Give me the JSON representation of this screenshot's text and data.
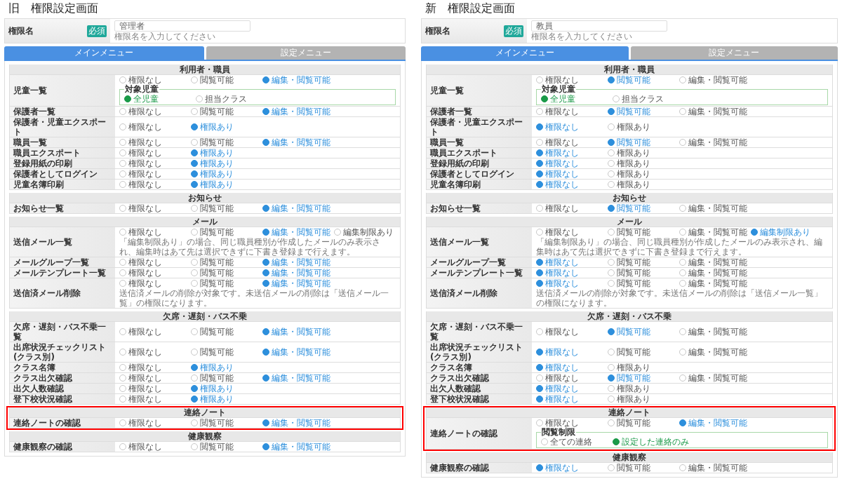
{
  "left": {
    "heading": "旧　権限設定画面",
    "name_field": {
      "label": "権限名",
      "badge": "必須",
      "value": "管理者",
      "hint": "権限名を入力してください"
    },
    "tabs": [
      {
        "label": "メインメニュー",
        "selected": true
      },
      {
        "label": "設定メニュー",
        "selected": false
      }
    ],
    "sections": [
      {
        "title": "利用者・職員",
        "highlighted": false,
        "rows": [
          {
            "label": "児童一覧",
            "options": [
              {
                "label": "権限なし",
                "selected": false
              },
              {
                "label": "閲覧可能",
                "selected": false
              },
              {
                "label": "編集・閲覧可能",
                "selected": true
              }
            ],
            "sub": {
              "title": "対象児童",
              "options": [
                {
                  "label": "全児童",
                  "selected": true
                },
                {
                  "label": "担当クラス",
                  "selected": false
                }
              ]
            }
          },
          {
            "label": "保護者一覧",
            "options": [
              {
                "label": "権限なし",
                "selected": false
              },
              {
                "label": "閲覧可能",
                "selected": false
              },
              {
                "label": "編集・閲覧可能",
                "selected": true
              }
            ]
          },
          {
            "label": "保護者・児童エクスポート",
            "options": [
              {
                "label": "権限なし",
                "selected": false
              },
              {
                "label": "権限あり",
                "selected": true
              }
            ]
          },
          {
            "label": "職員一覧",
            "options": [
              {
                "label": "権限なし",
                "selected": false
              },
              {
                "label": "閲覧可能",
                "selected": false
              },
              {
                "label": "編集・閲覧可能",
                "selected": true
              }
            ]
          },
          {
            "label": "職員エクスポート",
            "options": [
              {
                "label": "権限なし",
                "selected": false
              },
              {
                "label": "権限あり",
                "selected": true
              }
            ]
          },
          {
            "label": "登録用紙の印刷",
            "options": [
              {
                "label": "権限なし",
                "selected": false
              },
              {
                "label": "権限あり",
                "selected": true
              }
            ]
          },
          {
            "label": "保護者としてログイン",
            "options": [
              {
                "label": "権限なし",
                "selected": false
              },
              {
                "label": "権限あり",
                "selected": true
              }
            ]
          },
          {
            "label": "児童名簿印刷",
            "options": [
              {
                "label": "権限なし",
                "selected": false
              },
              {
                "label": "権限あり",
                "selected": true
              }
            ]
          }
        ]
      },
      {
        "title": "お知らせ",
        "highlighted": false,
        "rows": [
          {
            "label": "お知らせ一覧",
            "options": [
              {
                "label": "権限なし",
                "selected": false
              },
              {
                "label": "閲覧可能",
                "selected": false
              },
              {
                "label": "編集・閲覧可能",
                "selected": true
              }
            ]
          }
        ]
      },
      {
        "title": "メール",
        "highlighted": false,
        "rows": [
          {
            "label": "送信メール一覧",
            "options": [
              {
                "label": "権限なし",
                "selected": false
              },
              {
                "label": "閲覧可能",
                "selected": false
              },
              {
                "label": "編集・閲覧可能",
                "selected": true
              },
              {
                "label": "編集制限あり",
                "selected": false
              }
            ],
            "note": "「編集制限あり」の場合、同じ職員種別が作成したメールのみ表示され、編集時はあて先は選択できずに下書き登録まで行えます。"
          },
          {
            "label": "メールグループ一覧",
            "options": [
              {
                "label": "権限なし",
                "selected": false
              },
              {
                "label": "閲覧可能",
                "selected": false
              },
              {
                "label": "編集・閲覧可能",
                "selected": true
              }
            ]
          },
          {
            "label": "メールテンプレート一覧",
            "options": [
              {
                "label": "権限なし",
                "selected": false
              },
              {
                "label": "閲覧可能",
                "selected": false
              },
              {
                "label": "編集・閲覧可能",
                "selected": true
              }
            ]
          },
          {
            "label": "送信済メール削除",
            "options": [
              {
                "label": "権限なし",
                "selected": false
              },
              {
                "label": "閲覧可能",
                "selected": false
              },
              {
                "label": "編集・閲覧可能",
                "selected": true
              }
            ],
            "note": "送信済メールの削除が対象です。未送信メールの削除は「送信メール一覧」の権限になります。"
          }
        ]
      },
      {
        "title": "欠席・遅刻・バス不乗",
        "highlighted": false,
        "rows": [
          {
            "label": "欠席・遅刻・バス不乗一覧",
            "options": [
              {
                "label": "権限なし",
                "selected": false
              },
              {
                "label": "閲覧可能",
                "selected": false
              },
              {
                "label": "編集・閲覧可能",
                "selected": true
              }
            ]
          },
          {
            "label": "出席状況チェックリスト(クラス別)",
            "options": [
              {
                "label": "権限なし",
                "selected": false
              },
              {
                "label": "閲覧可能",
                "selected": false
              },
              {
                "label": "編集・閲覧可能",
                "selected": true
              }
            ]
          },
          {
            "label": "クラス名簿",
            "options": [
              {
                "label": "権限なし",
                "selected": false
              },
              {
                "label": "権限あり",
                "selected": true
              }
            ]
          },
          {
            "label": "クラス出欠確認",
            "options": [
              {
                "label": "権限なし",
                "selected": false
              },
              {
                "label": "閲覧可能",
                "selected": false
              },
              {
                "label": "編集・閲覧可能",
                "selected": true
              }
            ]
          },
          {
            "label": "出欠人数確認",
            "options": [
              {
                "label": "権限なし",
                "selected": false
              },
              {
                "label": "権限あり",
                "selected": true
              }
            ]
          },
          {
            "label": "登下校状況確認",
            "options": [
              {
                "label": "権限なし",
                "selected": false
              },
              {
                "label": "権限あり",
                "selected": true
              }
            ]
          }
        ]
      },
      {
        "title": "連絡ノート",
        "highlighted": true,
        "rows": [
          {
            "label": "連絡ノートの確認",
            "options": [
              {
                "label": "権限なし",
                "selected": false
              },
              {
                "label": "閲覧可能",
                "selected": false
              },
              {
                "label": "編集・閲覧可能",
                "selected": true
              }
            ]
          }
        ]
      },
      {
        "title": "健康観察",
        "highlighted": false,
        "rows": [
          {
            "label": "健康観察の確認",
            "options": [
              {
                "label": "権限なし",
                "selected": false
              },
              {
                "label": "閲覧可能",
                "selected": false
              },
              {
                "label": "編集・閲覧可能",
                "selected": true
              }
            ]
          }
        ]
      }
    ]
  },
  "right": {
    "heading": "新　権限設定画面",
    "name_field": {
      "label": "権限名",
      "badge": "必須",
      "value": "教員",
      "hint": "権限名を入力してください"
    },
    "tabs": [
      {
        "label": "メインメニュー",
        "selected": true
      },
      {
        "label": "設定メニュー",
        "selected": false
      }
    ],
    "sections": [
      {
        "title": "利用者・職員",
        "highlighted": false,
        "rows": [
          {
            "label": "児童一覧",
            "options": [
              {
                "label": "権限なし",
                "selected": false
              },
              {
                "label": "閲覧可能",
                "selected": true
              },
              {
                "label": "編集・閲覧可能",
                "selected": false
              }
            ],
            "sub": {
              "title": "対象児童",
              "options": [
                {
                  "label": "全児童",
                  "selected": true
                },
                {
                  "label": "担当クラス",
                  "selected": false
                }
              ]
            }
          },
          {
            "label": "保護者一覧",
            "options": [
              {
                "label": "権限なし",
                "selected": false
              },
              {
                "label": "閲覧可能",
                "selected": true
              },
              {
                "label": "編集・閲覧可能",
                "selected": false
              }
            ]
          },
          {
            "label": "保護者・児童エクスポート",
            "options": [
              {
                "label": "権限なし",
                "selected": true
              },
              {
                "label": "権限あり",
                "selected": false
              }
            ]
          },
          {
            "label": "職員一覧",
            "options": [
              {
                "label": "権限なし",
                "selected": false
              },
              {
                "label": "閲覧可能",
                "selected": true
              },
              {
                "label": "編集・閲覧可能",
                "selected": false
              }
            ]
          },
          {
            "label": "職員エクスポート",
            "options": [
              {
                "label": "権限なし",
                "selected": true
              },
              {
                "label": "権限あり",
                "selected": false
              }
            ]
          },
          {
            "label": "登録用紙の印刷",
            "options": [
              {
                "label": "権限なし",
                "selected": true
              },
              {
                "label": "権限あり",
                "selected": false
              }
            ]
          },
          {
            "label": "保護者としてログイン",
            "options": [
              {
                "label": "権限なし",
                "selected": true
              },
              {
                "label": "権限あり",
                "selected": false
              }
            ]
          },
          {
            "label": "児童名簿印刷",
            "options": [
              {
                "label": "権限なし",
                "selected": true
              },
              {
                "label": "権限あり",
                "selected": false
              }
            ]
          }
        ]
      },
      {
        "title": "お知らせ",
        "highlighted": false,
        "rows": [
          {
            "label": "お知らせ一覧",
            "options": [
              {
                "label": "権限なし",
                "selected": false
              },
              {
                "label": "閲覧可能",
                "selected": true
              },
              {
                "label": "編集・閲覧可能",
                "selected": false
              }
            ]
          }
        ]
      },
      {
        "title": "メール",
        "highlighted": false,
        "rows": [
          {
            "label": "送信メール一覧",
            "options": [
              {
                "label": "権限なし",
                "selected": false
              },
              {
                "label": "閲覧可能",
                "selected": false
              },
              {
                "label": "編集・閲覧可能",
                "selected": false
              },
              {
                "label": "編集制限あり",
                "selected": true
              }
            ],
            "note": "「編集制限あり」の場合、同じ職員種別が作成したメールのみ表示され、編集時はあて先は選択できずに下書き登録まで行えます。"
          },
          {
            "label": "メールグループ一覧",
            "options": [
              {
                "label": "権限なし",
                "selected": true
              },
              {
                "label": "閲覧可能",
                "selected": false
              },
              {
                "label": "編集・閲覧可能",
                "selected": false
              }
            ]
          },
          {
            "label": "メールテンプレート一覧",
            "options": [
              {
                "label": "権限なし",
                "selected": true
              },
              {
                "label": "閲覧可能",
                "selected": false
              },
              {
                "label": "編集・閲覧可能",
                "selected": false
              }
            ]
          },
          {
            "label": "送信済メール削除",
            "options": [
              {
                "label": "権限なし",
                "selected": true
              },
              {
                "label": "閲覧可能",
                "selected": false
              },
              {
                "label": "編集・閲覧可能",
                "selected": false
              }
            ],
            "note": "送信済メールの削除が対象です。未送信メールの削除は「送信メール一覧」の権限になります。"
          }
        ]
      },
      {
        "title": "欠席・遅刻・バス不乗",
        "highlighted": false,
        "rows": [
          {
            "label": "欠席・遅刻・バス不乗一覧",
            "options": [
              {
                "label": "権限なし",
                "selected": false
              },
              {
                "label": "閲覧可能",
                "selected": true
              },
              {
                "label": "編集・閲覧可能",
                "selected": false
              }
            ]
          },
          {
            "label": "出席状況チェックリスト(クラス別)",
            "options": [
              {
                "label": "権限なし",
                "selected": true
              },
              {
                "label": "閲覧可能",
                "selected": false
              },
              {
                "label": "編集・閲覧可能",
                "selected": false
              }
            ]
          },
          {
            "label": "クラス名簿",
            "options": [
              {
                "label": "権限なし",
                "selected": true
              },
              {
                "label": "権限あり",
                "selected": false
              }
            ]
          },
          {
            "label": "クラス出欠確認",
            "options": [
              {
                "label": "権限なし",
                "selected": false
              },
              {
                "label": "閲覧可能",
                "selected": true
              },
              {
                "label": "編集・閲覧可能",
                "selected": false
              }
            ]
          },
          {
            "label": "出欠人数確認",
            "options": [
              {
                "label": "権限なし",
                "selected": true
              },
              {
                "label": "権限あり",
                "selected": false
              }
            ]
          },
          {
            "label": "登下校状況確認",
            "options": [
              {
                "label": "権限なし",
                "selected": true
              },
              {
                "label": "権限あり",
                "selected": false
              }
            ]
          }
        ]
      },
      {
        "title": "連絡ノート",
        "highlighted": true,
        "rows": [
          {
            "label": "連絡ノートの確認",
            "options": [
              {
                "label": "権限なし",
                "selected": false
              },
              {
                "label": "閲覧可能",
                "selected": false
              },
              {
                "label": "編集・閲覧可能",
                "selected": true
              }
            ],
            "sub": {
              "title": "閲覧制限",
              "options": [
                {
                  "label": "全ての連絡",
                  "selected": false
                },
                {
                  "label": "設定した連絡のみ",
                  "selected": true
                }
              ]
            }
          }
        ]
      },
      {
        "title": "健康観察",
        "highlighted": false,
        "rows": [
          {
            "label": "健康観察の確認",
            "options": [
              {
                "label": "権限なし",
                "selected": true
              },
              {
                "label": "閲覧可能",
                "selected": false
              },
              {
                "label": "編集・閲覧可能",
                "selected": false
              }
            ]
          }
        ]
      }
    ]
  }
}
